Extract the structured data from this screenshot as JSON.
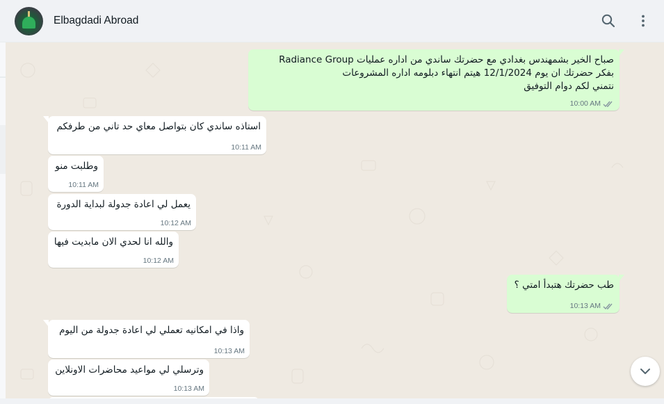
{
  "header": {
    "contact_name": "Elbagdadi Abroad",
    "icons": {
      "avatar": "contact-avatar-mosque",
      "search": "search-icon",
      "menu": "more-vertical-icon"
    }
  },
  "messages": [
    {
      "direction": "outgoing",
      "lines": [
        "صباح الخير بشمهندس بغدادي مع حضرتك ساندي من اداره عمليات Radiance Group",
        "بفكر حضرتك ان يوم  12/1/2024 هيتم انتهاء دبلومه اداره المشروعات",
        "نتمني لكم دوام التوفيق"
      ],
      "time": "10:00 AM",
      "status": "read"
    },
    {
      "direction": "incoming",
      "lines": [
        "استاذه ساندي كان بتواصل معاي حد تاني من طرفكم"
      ],
      "time": "10:11 AM"
    },
    {
      "direction": "incoming",
      "lines": [
        "وطلبت منو"
      ],
      "time": "10:11 AM"
    },
    {
      "direction": "incoming",
      "lines": [
        "يعمل لي اعادة جدولة لبداية الدورة"
      ],
      "time": "10:12 AM"
    },
    {
      "direction": "incoming",
      "lines": [
        "والله انا لحدي الان مابديت فيها"
      ],
      "time": "10:12 AM"
    },
    {
      "direction": "outgoing",
      "lines": [
        "طب حضرتك هتبدأ امتي ؟"
      ],
      "time": "10:13 AM",
      "status": "read"
    },
    {
      "direction": "incoming",
      "lines": [
        "واذا في امكانيه تعملي لي اعادة جدولة من اليوم"
      ],
      "time": "10:13 AM"
    },
    {
      "direction": "incoming",
      "lines": [
        "وترسلي لي مواعيد محاضرات الاونلاين"
      ],
      "time": "10:13 AM"
    }
  ],
  "colors": {
    "incoming_bubble": "#ffffff",
    "outgoing_bubble": "#d9fdd3",
    "chat_background": "#efeae2",
    "read_tick": "#53bdeb"
  },
  "scroll_down_icon": "chevron-down-icon"
}
